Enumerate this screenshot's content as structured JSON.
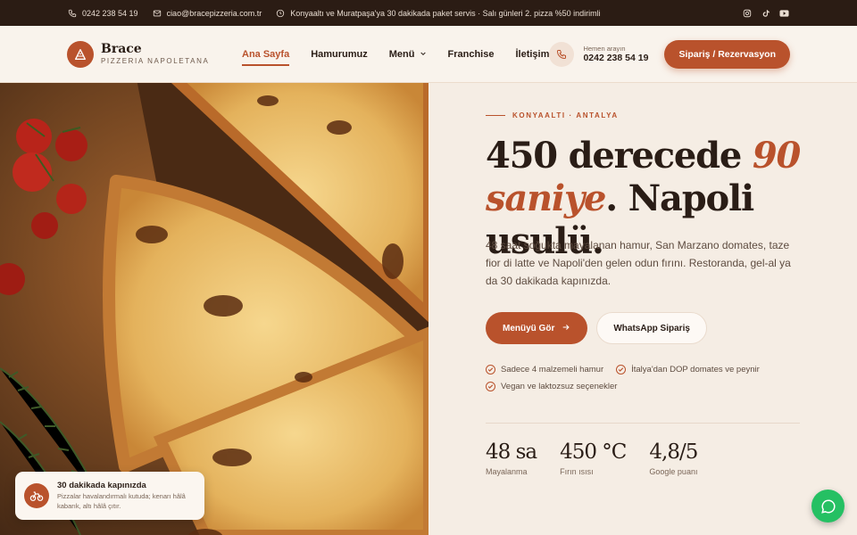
{
  "topbar": {
    "phone": "0242 238 54 19",
    "email": "ciao@bracepizzeria.com.tr",
    "notice": "Konyaaltı ve Muratpaşa'ya 30 dakikada paket servis · Salı günleri 2. pizza %50 indirimli",
    "social": [
      "instagram-icon",
      "tiktok-icon",
      "youtube-icon"
    ]
  },
  "header": {
    "logo_name": "Brace",
    "logo_sub": "PIZZERIA NAPOLETANA",
    "nav": [
      {
        "label": "Ana Sayfa",
        "active": true
      },
      {
        "label": "Hamurumuz",
        "active": false
      },
      {
        "label": "Menü",
        "active": false,
        "dropdown": true
      },
      {
        "label": "Franchise",
        "active": false
      },
      {
        "label": "İletişim",
        "active": false
      }
    ],
    "call_label": "Hemen arayın",
    "call_number": "0242 238 54 19",
    "order_button": "Sipariş / Rezervasyon"
  },
  "hero": {
    "eyebrow": "KONYAALTI · ANTALYA",
    "headline_part1": "450 derecede ",
    "headline_accent1": "90",
    "headline_accent2": "saniye",
    "headline_part2": ". Napoli usulü.",
    "description": "48 saat soğukta mayalanan hamur, San Marzano domates, taze fior di latte ve Napoli'den gelen odun fırını. Restoranda, gel-al ya da 30 dakikada kapınızda.",
    "cta_primary": "Menüyü Gör",
    "cta_secondary": "WhatsApp Sipariş",
    "features": [
      "Sadece 4 malzemeli hamur",
      "İtalya'dan DOP domates ve peynir",
      "Vegan ve laktozsuz seçenekler"
    ],
    "stats": [
      {
        "value": "48 sa",
        "label": "Mayalanma"
      },
      {
        "value": "450 °C",
        "label": "Fırın ısısı"
      },
      {
        "value": "4,8/5",
        "label": "Google puanı"
      }
    ]
  },
  "delivery_card": {
    "title": "30 dakikada kapınızda",
    "text": "Pizzalar havalandırmalı kutuda; kenarı hâlâ kabarık, altı hâlâ çıtır."
  },
  "colors": {
    "accent": "#b9522c",
    "topbar_bg": "#2b1c14",
    "page_bg": "#f5ede4",
    "whatsapp": "#25c063"
  }
}
